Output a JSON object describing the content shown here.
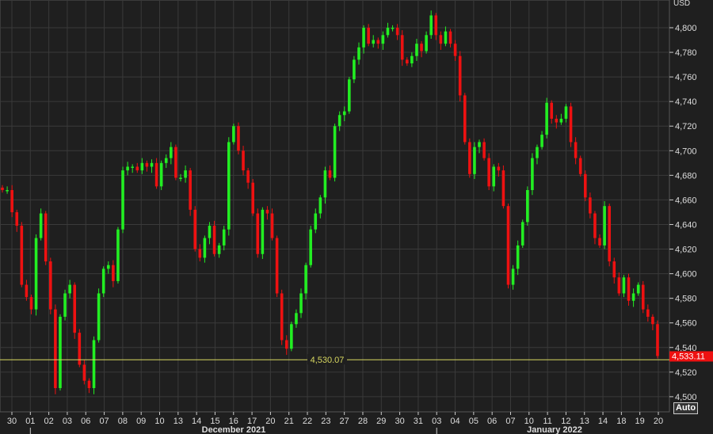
{
  "chart_data": {
    "type": "candlestick",
    "currency_label": "USD",
    "y_axis": {
      "min": 4490,
      "max": 4815,
      "ticks": [
        4500,
        4520,
        4540,
        4560,
        4580,
        4600,
        4620,
        4640,
        4660,
        4680,
        4700,
        4720,
        4740,
        4760,
        4780,
        4800
      ]
    },
    "x_ticks": [
      "30",
      "01",
      "02",
      "03",
      "06",
      "07",
      "08",
      "09",
      "10",
      "13",
      "14",
      "15",
      "16",
      "17",
      "20",
      "21",
      "22",
      "23",
      "27",
      "28",
      "29",
      "30",
      "31",
      "03",
      "04",
      "05",
      "06",
      "07",
      "10",
      "11",
      "12",
      "13",
      "14",
      "18",
      "19",
      "20"
    ],
    "month_labels": [
      {
        "label": "December 2021",
        "after_tick": 1
      },
      {
        "label": "January 2022",
        "after_tick": 23
      }
    ],
    "closes": [
      4668,
      4668,
      4650,
      4639,
      4591,
      4581,
      4571,
      4629,
      4649,
      4610,
      4571,
      4507,
      4565,
      4584,
      4591,
      4552,
      4526,
      4513,
      4507,
      4546,
      4584,
      4604,
      4607,
      4594,
      4636,
      4684,
      4687,
      4687,
      4684,
      4690,
      4687,
      4690,
      4671,
      4690,
      4694,
      4703,
      4678,
      4678,
      4684,
      4652,
      4620,
      4613,
      4629,
      4639,
      4616,
      4623,
      4636,
      4707,
      4720,
      4700,
      4684,
      4674,
      4649,
      4616,
      4652,
      4649,
      4629,
      4584,
      4546,
      4539,
      4559,
      4568,
      4584,
      4607,
      4636,
      4649,
      4662,
      4684,
      4678,
      4720,
      4729,
      4732,
      4758,
      4774,
      4784,
      4800,
      4787,
      4790,
      4787,
      4794,
      4800,
      4800,
      4794,
      4774,
      4771,
      4777,
      4787,
      4781,
      4794,
      4810,
      4794,
      4787,
      4797,
      4787,
      4777,
      4745,
      4707,
      4681,
      4703,
      4707,
      4694,
      4671,
      4687,
      4684,
      4655,
      4591,
      4604,
      4623,
      4642,
      4668,
      4694,
      4703,
      4713,
      4739,
      4726,
      4723,
      4726,
      4736,
      4707,
      4694,
      4681,
      4662,
      4649,
      4629,
      4623,
      4655,
      4610,
      4597,
      4584,
      4597,
      4578,
      4584,
      4591,
      4571,
      4565,
      4559,
      4533.11
    ],
    "reference_line": {
      "value": 4530.07,
      "label": "4,530.07"
    },
    "last_price": {
      "value": 4533.11,
      "label": "4,533.11"
    },
    "grid": true,
    "colors": {
      "up": "#22ee22",
      "down": "#ee1111",
      "background": "#1f1f1f",
      "grid": "#3a3a3a",
      "reference": "#d8d860"
    }
  },
  "controls": {
    "auto_label": "Auto"
  }
}
